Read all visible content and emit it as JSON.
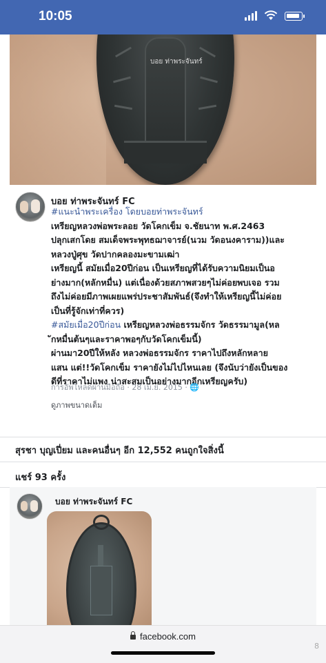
{
  "status_bar": {
    "time": "10:05",
    "icons": [
      "signal-icon",
      "wifi-icon",
      "battery-icon"
    ],
    "background": "#4267b2"
  },
  "top_photo": {
    "watermark": "บอย ท่าพระจันทร์"
  },
  "post": {
    "author": "บอย ท่าพระจันทร์ FC",
    "lines": [
      {
        "text": "#แนะนำพระเครื่อง โดยบอยท่าพระจันทร์",
        "tag": true
      },
      {
        "text": "เหรียญหลวงพ่อพระลอย วัดโคกเข็ม จ.ชัยนาท พ.ศ.2463",
        "tag": false
      },
      {
        "text": "ปลุกเสกโดย สมเด็จพระพุทธฌาจารย์(นวม วัดอนงคาราม))และ",
        "tag": false
      },
      {
        "text": "หลวงปู่ศุข วัดปากคลองมะขามเฒ่า",
        "tag": false
      },
      {
        "text": "เหรียญนี้ สมัยเมื่อ20ปีก่อน เป็นเหรียญที่ได้รับความนิยมเป็นอ",
        "tag": false
      },
      {
        "text": "ย่างมาก(หลักหมื่น) แต่เนื่องด้วยสภาพสวยๆไม่ค่อยพบเจอ รวม",
        "tag": false
      },
      {
        "text": "ถึงไม่ค่อยมีภาพเผยแพร่ประชาสัมพันธ์(จึงทำให้เหรียญนี้ไม่ค่อย",
        "tag": false
      },
      {
        "text": "เป็นที่รู้จักเท่าที่ควร)",
        "tag": false
      },
      {
        "text": "#สมัยเมื่อ20ปีก่อน",
        "tag": true,
        "rest": " เหรียญหลวงพ่อธรรมจักร วัดธรรมามูล(หล"
      },
      {
        "text": "ักหมื่นต้นๆและราคาพอๆกับวัดโคกเข็มนี้)",
        "tag": false
      },
      {
        "text": "ผ่านมา20ปีให้หลัง หลวงพ่อธรรมจักร ราคาไปถึงหลักหลาย",
        "tag": false
      },
      {
        "text": "แสน แต่!!วัดโคกเข็ม ราคายังไม่ไปไหนเลย (จึงนับว่ายังเป็นของ",
        "tag": false
      },
      {
        "text": "ดีที่ราคาไม่แพง น่าสะสมเป็นอย่างมากอีกเหรียญครับ)",
        "tag": false
      }
    ],
    "meta": "การอัพโหลดผ่านมือถือ · 28 เม.ย. 2015 · 🌐",
    "view_full": "ดูภาพขนาดเต็ม"
  },
  "engagement": {
    "likes": "สุรชา บุญเปี่ยม และคนอื่นๆ อีก 12,552 คนถูกใจสิ่งนี้",
    "shares": "แชร์ 93 ครั้ง"
  },
  "shared_post": {
    "author": "บอย ท่าพระจันทร์ FC"
  },
  "browser": {
    "url": "facebook.com"
  },
  "corner_mark": "8"
}
